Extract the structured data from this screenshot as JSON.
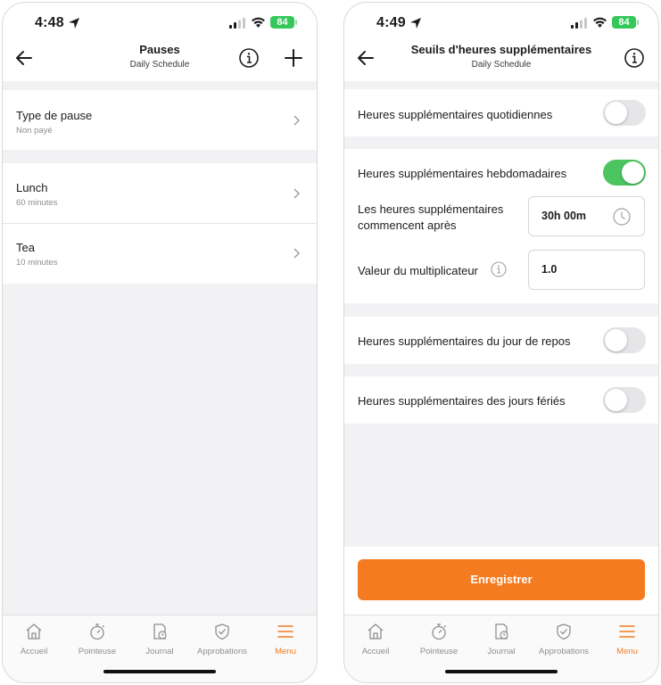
{
  "left": {
    "status": {
      "time": "4:48",
      "battery": "84"
    },
    "nav": {
      "title": "Pauses",
      "subtitle": "Daily Schedule"
    },
    "type_row": {
      "title": "Type de pause",
      "value": "Non payé"
    },
    "breaks": [
      {
        "name": "Lunch",
        "duration": "60 minutes"
      },
      {
        "name": "Tea",
        "duration": "10 minutes"
      }
    ]
  },
  "right": {
    "status": {
      "time": "4:49",
      "battery": "84"
    },
    "nav": {
      "title": "Seuils d'heures supplémentaires",
      "subtitle": "Daily Schedule"
    },
    "daily": {
      "label": "Heures supplémentaires quotidiennes",
      "enabled": false
    },
    "weekly": {
      "label": "Heures supplémentaires hebdomadaires",
      "enabled": true,
      "start_label_line1": "Les heures supplémentaires",
      "start_label_line2": "commencent après",
      "start_value": "30h 00m",
      "multiplier_label": "Valeur du multiplicateur",
      "multiplier_value": "1.0"
    },
    "rest_day": {
      "label": "Heures supplémentaires du jour de repos",
      "enabled": false
    },
    "holidays": {
      "label": "Heures supplémentaires des jours fériés",
      "enabled": false
    },
    "save_label": "Enregistrer"
  },
  "tabbar": [
    {
      "label": "Accueil",
      "icon": "home-icon"
    },
    {
      "label": "Pointeuse",
      "icon": "stopwatch-icon"
    },
    {
      "label": "Journal",
      "icon": "timesheet-icon"
    },
    {
      "label": "Approbations",
      "icon": "shield-check-icon"
    },
    {
      "label": "Menu",
      "icon": "menu-icon",
      "active": true
    }
  ],
  "colors": {
    "accent": "#f47b20",
    "toggle_on": "#4cc561",
    "battery": "#34c759"
  }
}
